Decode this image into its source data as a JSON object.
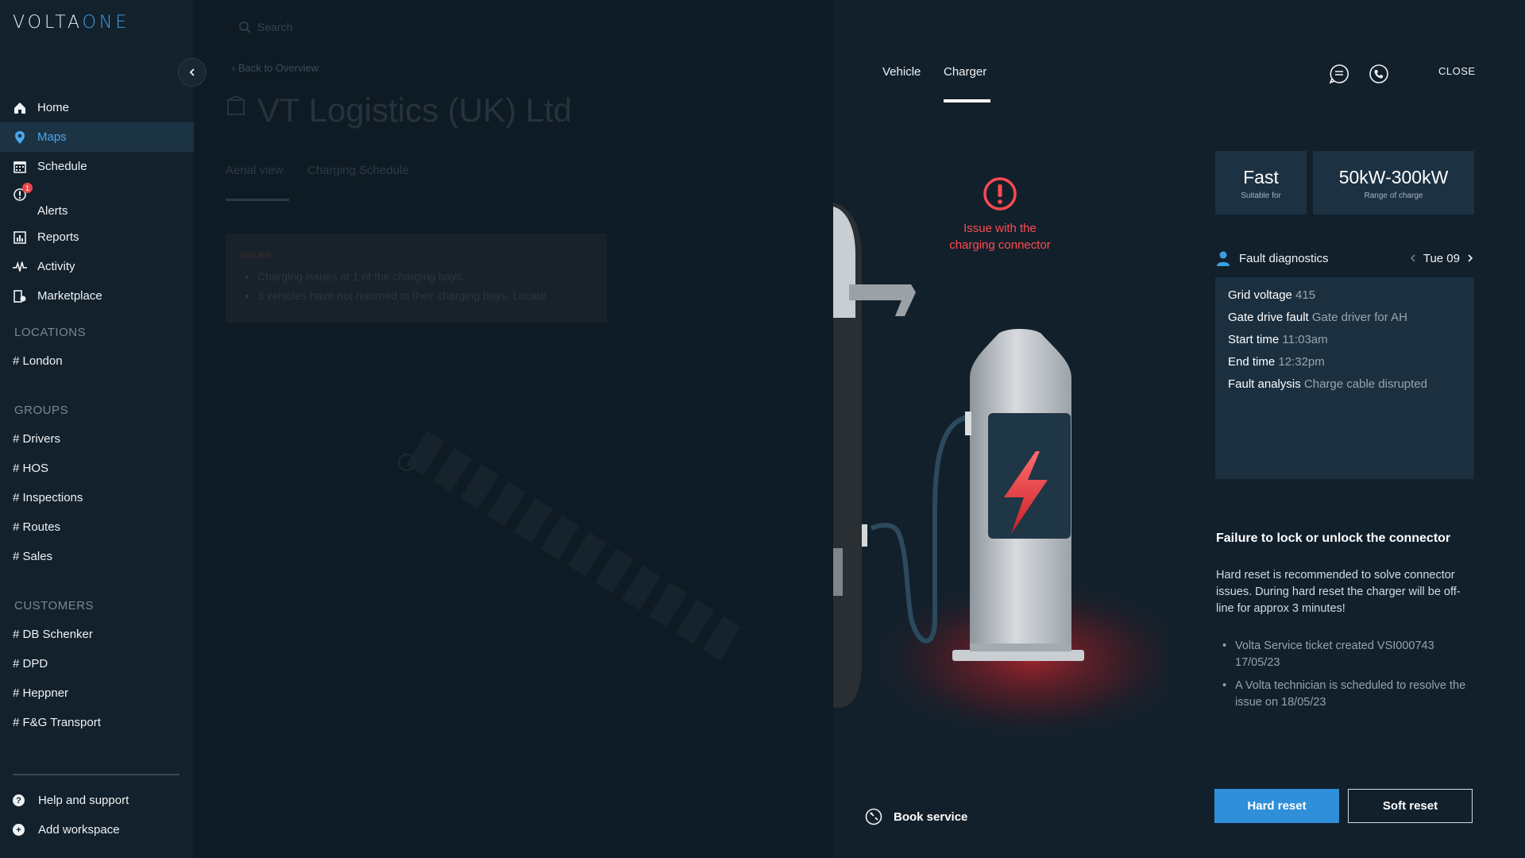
{
  "brand": {
    "logo_volta": "VOLTA",
    "logo_one": "ONE"
  },
  "sidebar": {
    "nav": [
      {
        "label": "Home",
        "icon": "home-icon"
      },
      {
        "label": "Maps",
        "icon": "map-pin-icon",
        "active": true
      },
      {
        "label": "Schedule",
        "icon": "calendar-icon"
      },
      {
        "label": "Alerts",
        "icon": "alert-icon",
        "badge": "1"
      },
      {
        "label": "Reports",
        "icon": "reports-icon"
      },
      {
        "label": "Activity",
        "icon": "activity-icon"
      },
      {
        "label": "Marketplace",
        "icon": "marketplace-icon"
      }
    ],
    "locations_heading": "LOCATIONS",
    "locations": [
      "# London"
    ],
    "groups_heading": "GROUPS",
    "groups": [
      "# Drivers",
      "# HOS",
      "# Inspections",
      "# Routes",
      "# Sales"
    ],
    "customers_heading": "CUSTOMERS",
    "customers": [
      "# DB Schenker",
      "# DPD",
      "# Heppner",
      "# F&G Transport"
    ],
    "footer": [
      {
        "label": "Help and support",
        "icon": "help-icon",
        "glyph": "?"
      },
      {
        "label": "Add workspace",
        "icon": "add-icon",
        "glyph": "+"
      }
    ]
  },
  "background_page": {
    "search_placeholder": "Search",
    "back_link": "Back to Overview",
    "title": "VT Logistics (UK) Ltd",
    "tabs": [
      "Aerial view",
      "Charging Schedule"
    ],
    "issues_title": "issues",
    "issues": [
      "Charging issues at 1 of the charging bays.",
      "3 vehicles have not returned to their charging bays.  Locate"
    ]
  },
  "panel": {
    "tabs": [
      "Vehicle",
      "Charger"
    ],
    "active_tab": "Charger",
    "close_label": "CLOSE",
    "issue_text": "Issue with the charging connector",
    "stats": [
      {
        "value": "Fast",
        "label": "Suitable for"
      },
      {
        "value": "50kW-300kW",
        "label": "Range of charge"
      }
    ],
    "fault_title": "Fault diagnostics",
    "fault_date": "Tue 09",
    "diagnostics": [
      {
        "key": "Grid voltage",
        "value": "415"
      },
      {
        "key": "Gate drive fault",
        "value": "Gate driver for AH"
      },
      {
        "key": "Start time",
        "value": "11:03am"
      },
      {
        "key": "End time",
        "value": "12:32pm"
      },
      {
        "key": "Fault analysis",
        "value": "Charge cable disrupted"
      }
    ],
    "failure_title": "Failure to lock or unlock the connector",
    "failure_desc": "Hard reset is recommended to solve connector issues. During hard reset the charger will be off-line for approx 3 minutes!",
    "failure_list": [
      "Volta Service ticket created VSI000743 17/05/23",
      "A Volta technician is scheduled to resolve the issue on 18/05/23"
    ],
    "book_service": "Book service",
    "hard_reset": "Hard reset",
    "soft_reset": "Soft reset"
  },
  "colors": {
    "accent": "#2f8fd8",
    "alert": "#ff4a52",
    "sidebar": "#13212c"
  }
}
